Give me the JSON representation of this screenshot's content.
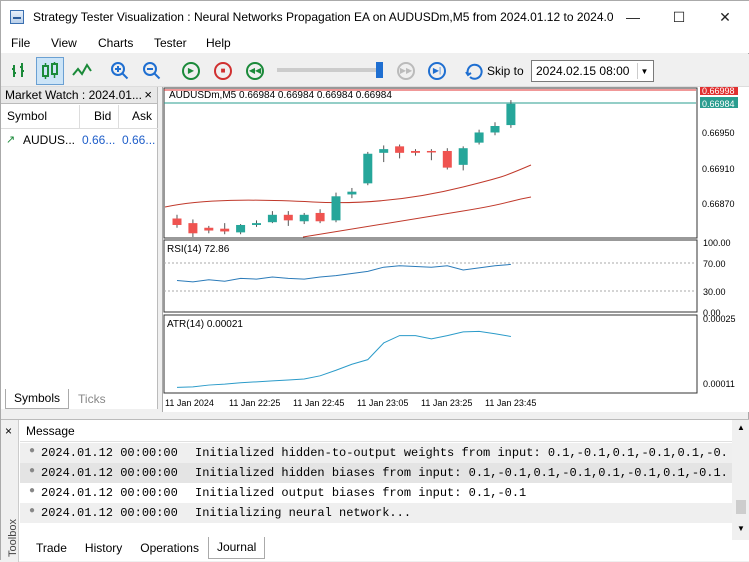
{
  "window": {
    "title": "Strategy Tester Visualization : Neural Networks Propagation EA on AUDUSDm,M5 from 2024.01.12 to 2024.01...",
    "minimize": "—",
    "maximize": "☐",
    "close": "✕"
  },
  "menu": [
    "File",
    "View",
    "Charts",
    "Tester",
    "Help"
  ],
  "toolbar": {
    "skip_label": "Skip to",
    "skip_date": "2024.02.15 08:00",
    "slider_position": 0.97
  },
  "market_watch": {
    "title": "Market Watch : 2024.01...",
    "close": "×",
    "columns": [
      "Symbol",
      "Bid",
      "Ask"
    ],
    "rows": [
      {
        "symbol": "AUDUS...",
        "bid": "0.66...",
        "ask": "0.66..."
      }
    ],
    "tabs": [
      "Symbols",
      "Ticks"
    ]
  },
  "chart": {
    "header": "AUDUSDm,M5  0.66984 0.66984 0.66984 0.66984",
    "price_labels": [
      "0.66998",
      "0.66984",
      "0.66950",
      "0.66910",
      "0.66870"
    ],
    "price_highlight_colors": {
      "ask": "#e03030",
      "bid": "#2a9d8f"
    },
    "rsi_label": "RSI(14) 72.86",
    "rsi_levels": [
      "100.00",
      "70.00",
      "30.00",
      "0.00"
    ],
    "atr_label": "ATR(14) 0.00021",
    "atr_levels": [
      "0.00025",
      "0.00011"
    ],
    "time_labels": [
      "11 Jan 2024",
      "11 Jan 22:25",
      "11 Jan 22:45",
      "11 Jan 23:05",
      "11 Jan 23:25",
      "11 Jan 23:45"
    ]
  },
  "chart_data": {
    "type": "candlestick",
    "candles": [
      {
        "o": 0.6686,
        "h": 0.66864,
        "l": 0.6685,
        "c": 0.66853
      },
      {
        "o": 0.66855,
        "h": 0.66859,
        "l": 0.6684,
        "c": 0.66844
      },
      {
        "o": 0.6685,
        "h": 0.66852,
        "l": 0.66844,
        "c": 0.66847
      },
      {
        "o": 0.66849,
        "h": 0.66855,
        "l": 0.66843,
        "c": 0.66846
      },
      {
        "o": 0.66845,
        "h": 0.66854,
        "l": 0.66843,
        "c": 0.66853
      },
      {
        "o": 0.66853,
        "h": 0.66858,
        "l": 0.66851,
        "c": 0.66855
      },
      {
        "o": 0.66856,
        "h": 0.66868,
        "l": 0.66855,
        "c": 0.66864
      },
      {
        "o": 0.66864,
        "h": 0.66868,
        "l": 0.66852,
        "c": 0.66858
      },
      {
        "o": 0.66857,
        "h": 0.66866,
        "l": 0.66854,
        "c": 0.66864
      },
      {
        "o": 0.66866,
        "h": 0.6687,
        "l": 0.66855,
        "c": 0.66857
      },
      {
        "o": 0.66858,
        "h": 0.66888,
        "l": 0.66856,
        "c": 0.66884
      },
      {
        "o": 0.66886,
        "h": 0.66893,
        "l": 0.66882,
        "c": 0.66889
      },
      {
        "o": 0.66898,
        "h": 0.66932,
        "l": 0.66896,
        "c": 0.6693
      },
      {
        "o": 0.66931,
        "h": 0.66939,
        "l": 0.66921,
        "c": 0.66935
      },
      {
        "o": 0.66938,
        "h": 0.6694,
        "l": 0.66925,
        "c": 0.66931
      },
      {
        "o": 0.66933,
        "h": 0.66935,
        "l": 0.66928,
        "c": 0.66931
      },
      {
        "o": 0.66933,
        "h": 0.66935,
        "l": 0.66923,
        "c": 0.66932
      },
      {
        "o": 0.66933,
        "h": 0.66936,
        "l": 0.66913,
        "c": 0.66915
      },
      {
        "o": 0.66918,
        "h": 0.66938,
        "l": 0.66912,
        "c": 0.66936
      },
      {
        "o": 0.66942,
        "h": 0.66956,
        "l": 0.6694,
        "c": 0.66953
      },
      {
        "o": 0.66953,
        "h": 0.66964,
        "l": 0.6695,
        "c": 0.6696
      },
      {
        "o": 0.66961,
        "h": 0.66988,
        "l": 0.66958,
        "c": 0.66984
      }
    ],
    "upper_band": [],
    "rsi": [
      45,
      43,
      46,
      44,
      48,
      47,
      50,
      48,
      47,
      50,
      52,
      55,
      58,
      64,
      66,
      65,
      64,
      66,
      60,
      63,
      66,
      68
    ],
    "atr": [
      0.0001,
      0.000101,
      0.000105,
      0.000107,
      0.00011,
      0.000112,
      0.000114,
      0.000116,
      0.000118,
      0.000125,
      0.000137,
      0.00015,
      0.00016,
      0.000196,
      0.000212,
      0.000212,
      0.000205,
      0.000212,
      0.00022,
      0.000221,
      0.000216,
      0.00021
    ]
  },
  "toolbox": {
    "label": "Toolbox",
    "close": "×",
    "column": "Message",
    "logs": [
      {
        "time": "2024.01.12 00:00:00",
        "msg": "Initialized hidden-to-output weights from input: 0.1,-0.1,0.1,-0.1,0.1,-0..."
      },
      {
        "time": "2024.01.12 00:00:00",
        "msg": "Initialized hidden biases from input: 0.1,-0.1,0.1,-0.1,0.1,-0.1,0.1,-0.1..."
      },
      {
        "time": "2024.01.12 00:00:00",
        "msg": "Initialized output biases from input: 0.1,-0.1"
      },
      {
        "time": "2024.01.12 00:00:00",
        "msg": "Initializing neural network..."
      }
    ],
    "tabs": [
      "Trade",
      "History",
      "Operations",
      "Journal"
    ]
  }
}
